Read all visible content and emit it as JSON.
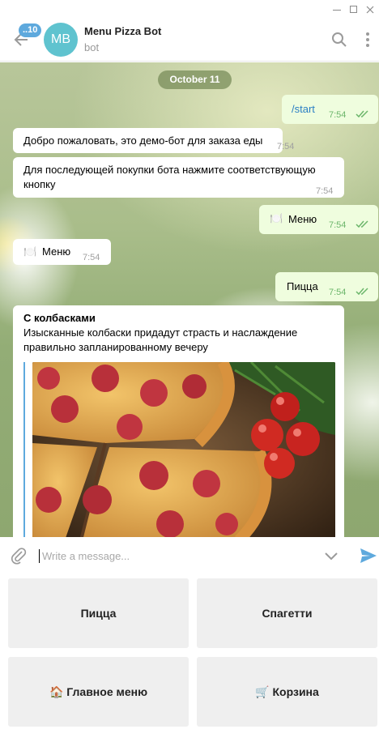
{
  "window": {
    "controls": [
      "minimize",
      "maximize",
      "close"
    ]
  },
  "header": {
    "back_icon": "arrow-left-icon",
    "unread_badge": "..10",
    "avatar_initials": "MB",
    "title": "Menu Pizza Bot",
    "subtitle": "bot",
    "search_icon": "search-icon",
    "more_icon": "more-vertical-icon"
  },
  "chat": {
    "date_separator": "October 11",
    "messages": [
      {
        "direction": "out",
        "text": "/start",
        "time": "7:54",
        "read": true
      },
      {
        "direction": "in",
        "text": "Добро пожаловать, это демо-бот для заказа еды",
        "time": "7:54"
      },
      {
        "direction": "in",
        "text": "Для последующей покупки бота нажмите соответствующую кнопку",
        "time": "7:54"
      },
      {
        "direction": "out",
        "emoji": "🍽️",
        "text": "Меню",
        "time": "7:54",
        "read": true
      },
      {
        "direction": "in",
        "emoji": "🍽️",
        "text": "Меню",
        "time": "7:54"
      },
      {
        "direction": "out",
        "text": "Пицца",
        "time": "7:54",
        "read": true
      },
      {
        "direction": "in",
        "title": "С колбасками",
        "text": "Изысканные колбаски придадут страсть и наслаждение правильно запланированному вечеру",
        "media": "pizza-photo"
      }
    ]
  },
  "composer": {
    "attach_icon": "paperclip-icon",
    "placeholder": "Write a message...",
    "value": "",
    "keyboard_toggle_icon": "chevron-down-icon",
    "send_icon": "send-icon"
  },
  "bot_keyboard": {
    "buttons": [
      {
        "label": "Пицца"
      },
      {
        "label": "Спагетти"
      },
      {
        "emoji": "🏠",
        "label": "Главное меню"
      },
      {
        "emoji": "🛒",
        "label": "Корзина"
      }
    ]
  },
  "colors": {
    "accent": "#5ea9dd",
    "avatar": "#5fc3cf",
    "outgoing_bubble": "#effdde",
    "incoming_bubble": "#ffffff",
    "read_check": "#6cb66b",
    "date_pill": "#7a8c5a",
    "keyboard_button": "#efefef"
  }
}
